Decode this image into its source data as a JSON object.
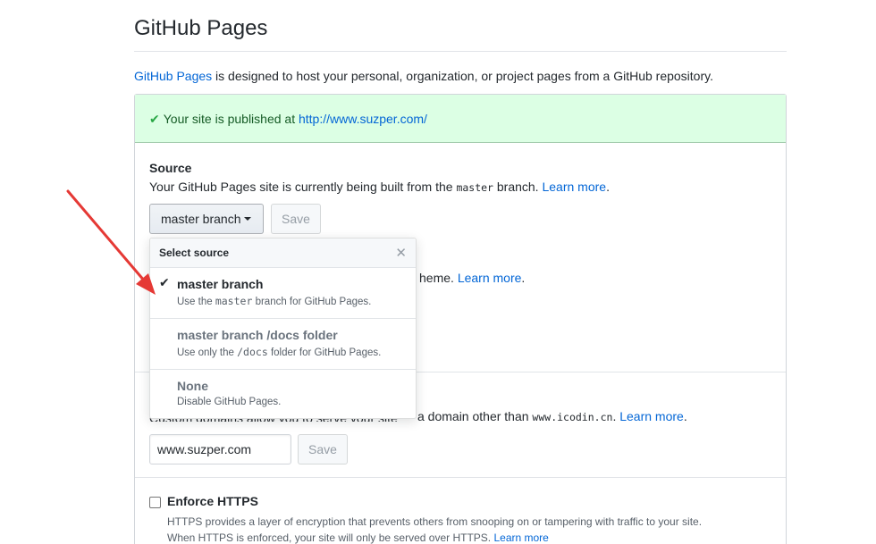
{
  "page": {
    "title": "GitHub Pages",
    "intro_link": "GitHub Pages",
    "intro_rest": " is designed to host your personal, organization, or project pages from a GitHub repository."
  },
  "flash": {
    "text": "Your site is published at ",
    "url": "http://www.suzper.com/",
    "icon": "check-icon",
    "color": "#28a745"
  },
  "source": {
    "heading": "Source",
    "desc_before": "Your GitHub Pages site is currently being built from the ",
    "branch_code": "master",
    "desc_after": " branch. ",
    "learn_more": "Learn more",
    "select_label": "master branch",
    "save_label": "Save"
  },
  "theme": {
    "text_visible": "heme. ",
    "learn_more": "Learn more"
  },
  "custom_domain": {
    "desc_clipped": "Custom domains allow you to serve your site",
    "desc_visible": "a domain other than ",
    "example_code": "www.icodin.cn",
    "desc_after": ". ",
    "learn_more": "Learn more",
    "input_value": "www.suzper.com",
    "save_label": "Save"
  },
  "https": {
    "label": "Enforce HTTPS",
    "line1": "HTTPS provides a layer of encryption that prevents others from snooping on or tampering with traffic to your site.",
    "line2": "When HTTPS is enforced, your site will only be served over HTTPS. ",
    "learn_more": "Learn more",
    "checked": false
  },
  "dropdown": {
    "header": "Select source",
    "close_icon": "close-icon",
    "items": [
      {
        "label": "master branch",
        "sub_before": "Use the ",
        "sub_code": "master",
        "sub_after": " branch for GitHub Pages.",
        "selected": true
      },
      {
        "label": "master branch /docs folder",
        "sub_before": "Use only the ",
        "sub_code": "/docs",
        "sub_after": " folder for GitHub Pages.",
        "selected": false
      },
      {
        "label": "None",
        "sub_before": "Disable GitHub Pages.",
        "sub_code": "",
        "sub_after": "",
        "selected": false
      }
    ]
  },
  "annotation": {
    "icon": "red-arrow-icon",
    "color": "#e53935"
  }
}
